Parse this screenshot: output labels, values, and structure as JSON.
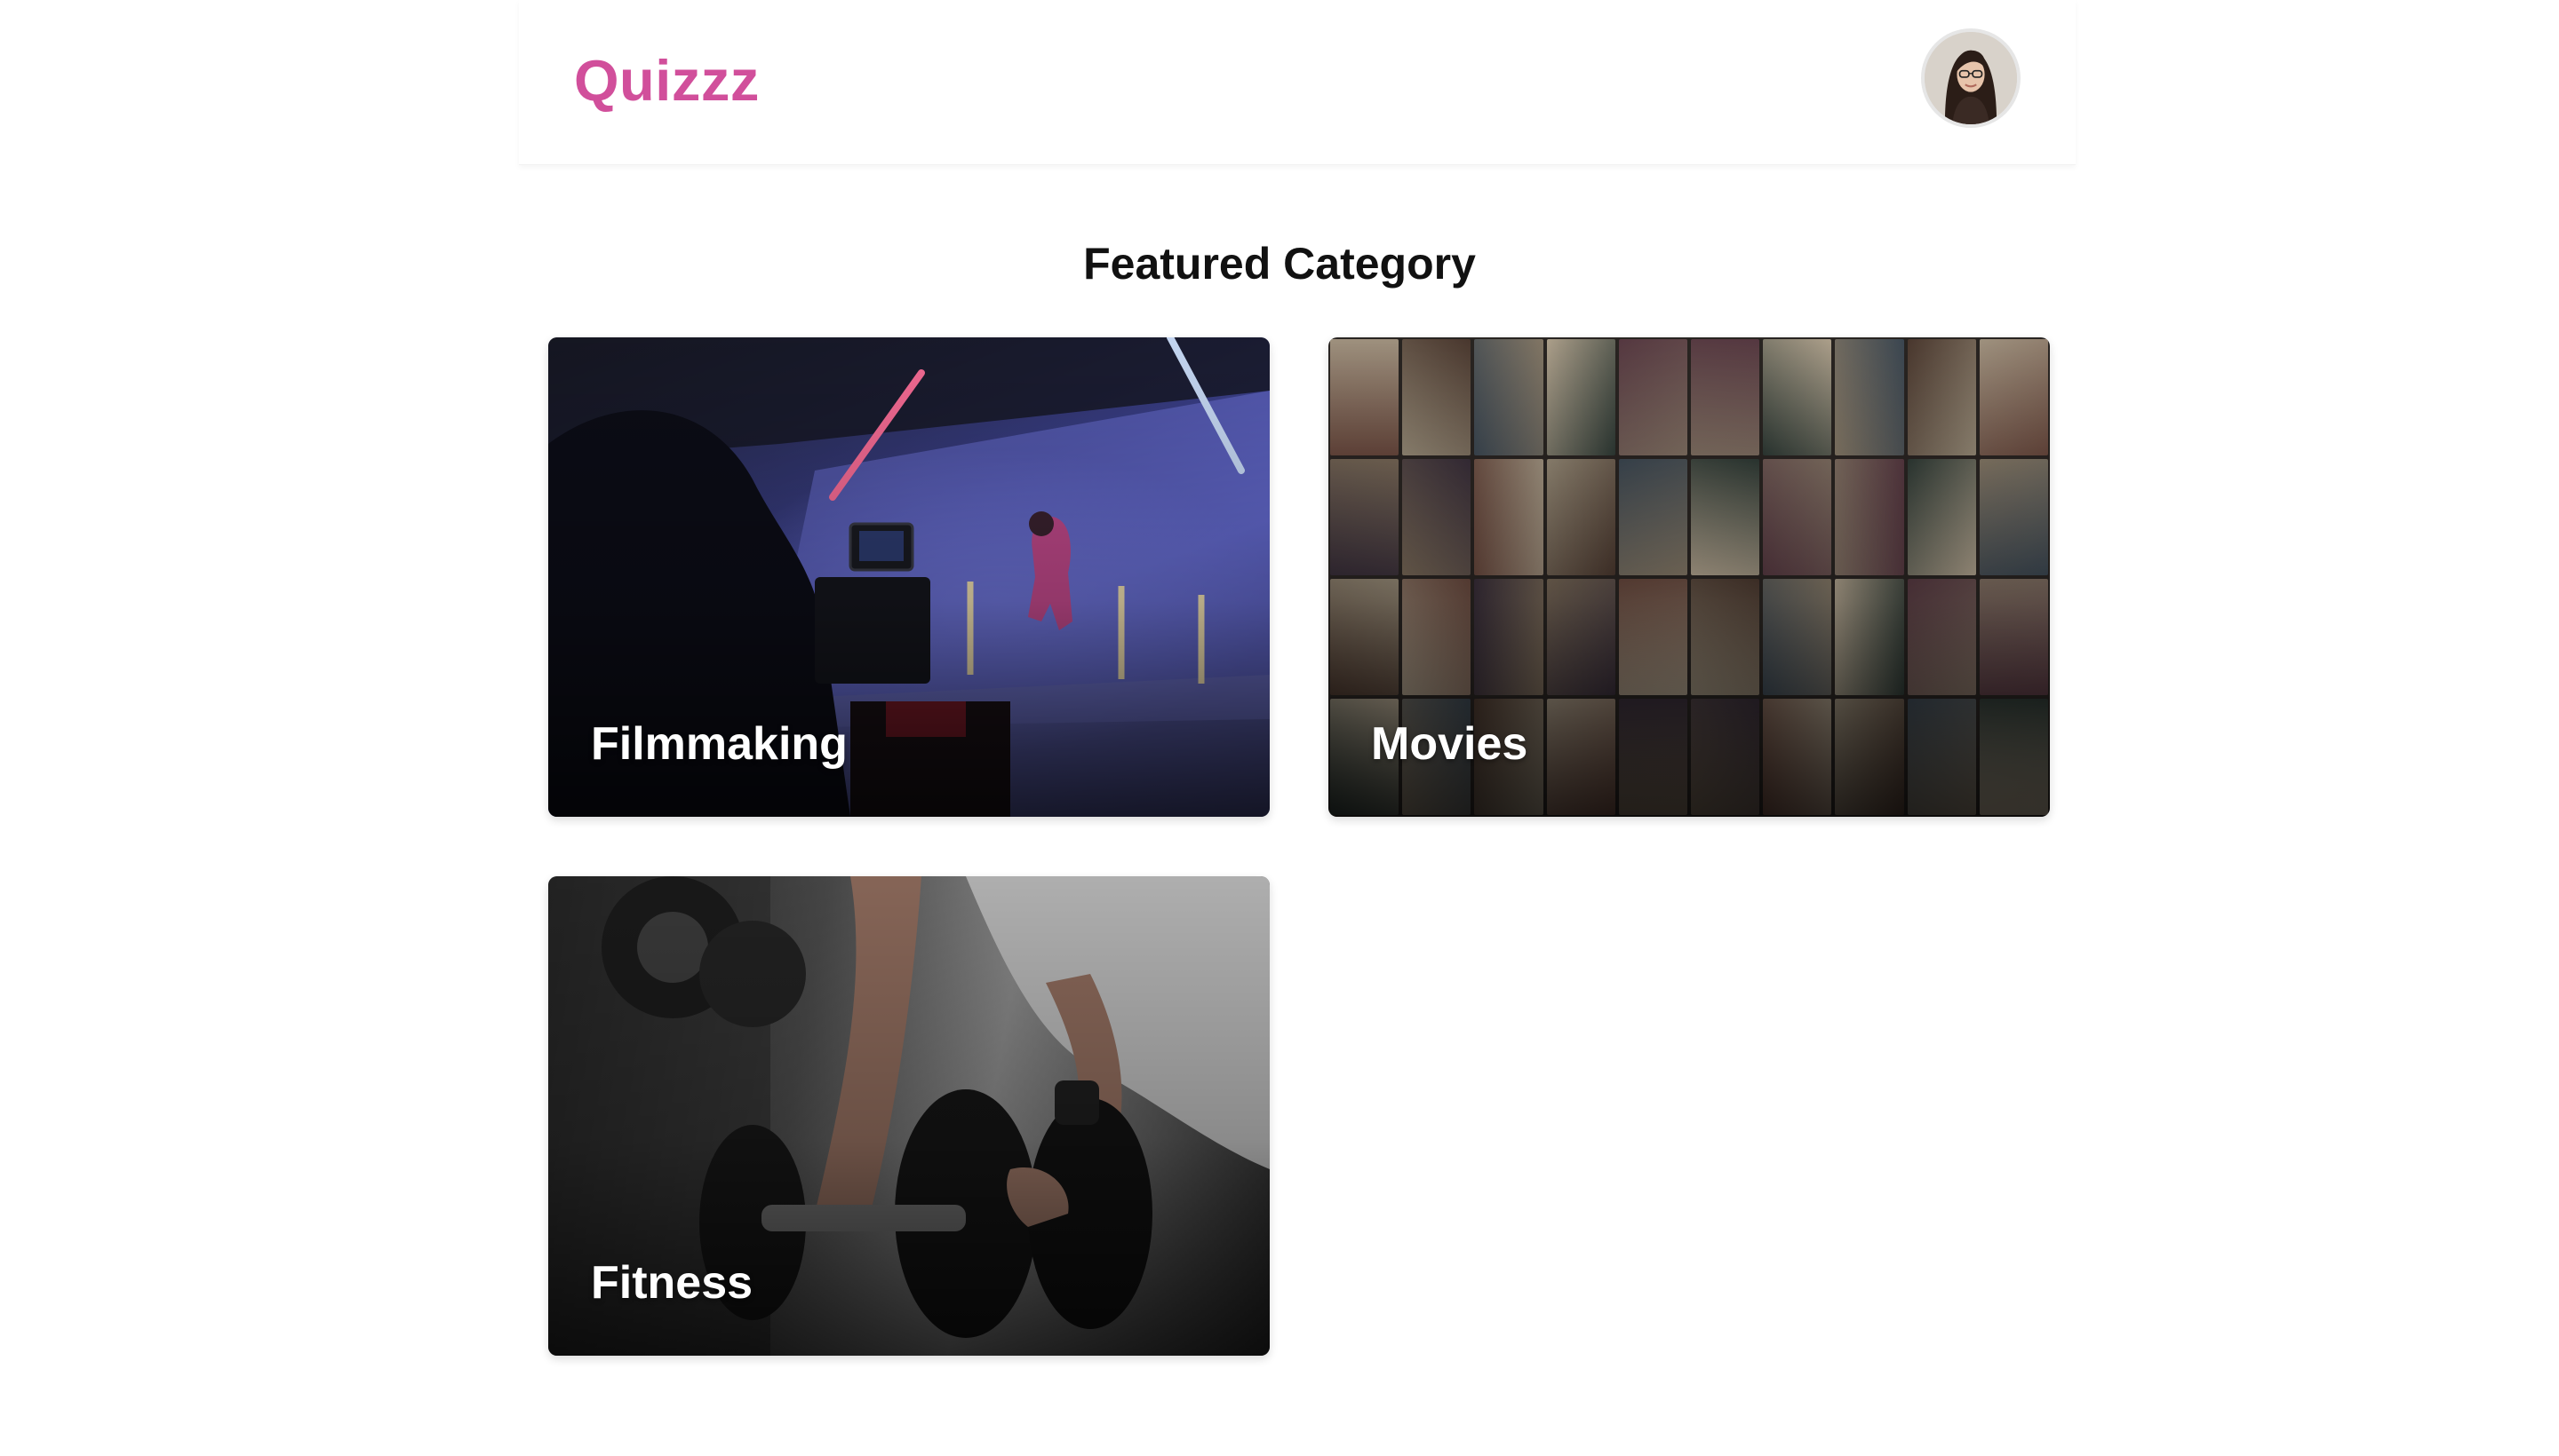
{
  "header": {
    "brand": "Quizzz",
    "brand_color": "#d14f9b",
    "avatar_icon": "user-avatar"
  },
  "main": {
    "section_title": "Featured Category",
    "categories": [
      {
        "label": "Filmmaking",
        "image": "film-studio-photo"
      },
      {
        "label": "Movies",
        "image": "movie-posters-photo"
      },
      {
        "label": "Fitness",
        "image": "dumbbell-workout-photo"
      }
    ]
  }
}
